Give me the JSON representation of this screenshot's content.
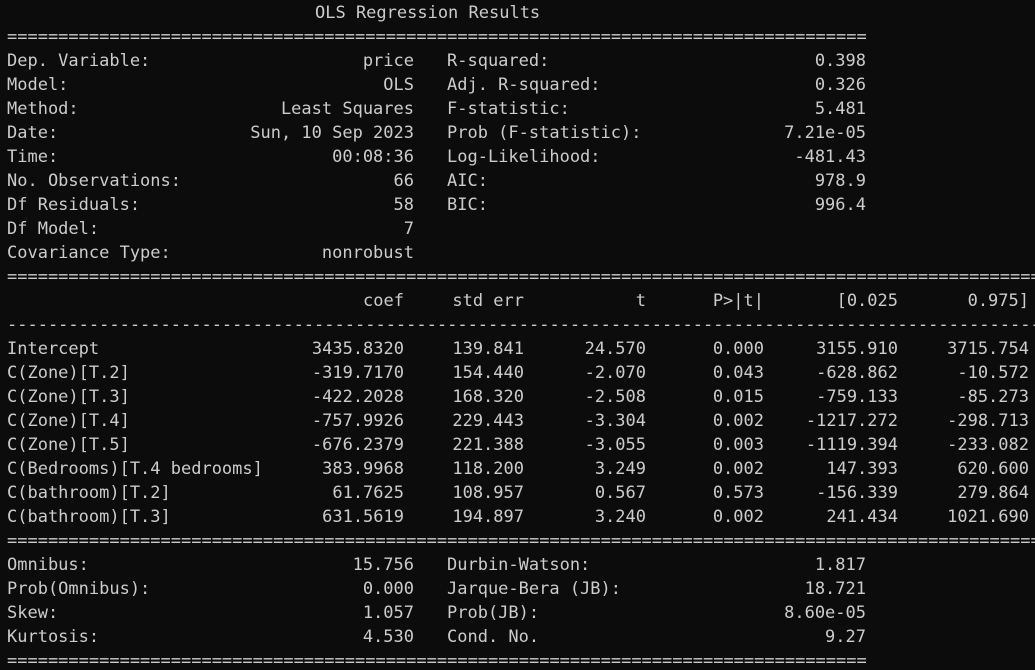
{
  "title": "OLS Regression Results",
  "rules": {
    "double_long": "=======================================================================================================================================================================",
    "double_short": "==============================================================================================================",
    "single_long": "-----------------------------------------------------------------------------------------------------------------------------------------------------------------------"
  },
  "summary": {
    "left": [
      {
        "label": "Dep. Variable:",
        "value": "price"
      },
      {
        "label": "Model:",
        "value": "OLS"
      },
      {
        "label": "Method:",
        "value": "Least Squares"
      },
      {
        "label": "Date:",
        "value": "Sun, 10 Sep 2023"
      },
      {
        "label": "Time:",
        "value": "00:08:36"
      },
      {
        "label": "No. Observations:",
        "value": "66"
      },
      {
        "label": "Df Residuals:",
        "value": "58"
      },
      {
        "label": "Df Model:",
        "value": "7"
      },
      {
        "label": "Covariance Type:",
        "value": "nonrobust"
      }
    ],
    "right": [
      {
        "label": "R-squared:",
        "value": "0.398"
      },
      {
        "label": "Adj. R-squared:",
        "value": "0.326"
      },
      {
        "label": "F-statistic:",
        "value": "5.481"
      },
      {
        "label": "Prob (F-statistic):",
        "value": "7.21e-05"
      },
      {
        "label": "Log-Likelihood:",
        "value": "-481.43"
      },
      {
        "label": "AIC:",
        "value": "978.9"
      },
      {
        "label": "BIC:",
        "value": "996.4"
      }
    ]
  },
  "coef_table": {
    "headers": [
      "coef",
      "std err",
      "t",
      "P>|t|",
      "[0.025",
      "0.975]"
    ],
    "rows": [
      {
        "name": "Intercept",
        "cells": [
          "3435.8320",
          "139.841",
          "24.570",
          "0.000",
          "3155.910",
          "3715.754"
        ]
      },
      {
        "name": "C(Zone)[T.2]",
        "cells": [
          "-319.7170",
          "154.440",
          "-2.070",
          "0.043",
          "-628.862",
          "-10.572"
        ]
      },
      {
        "name": "C(Zone)[T.3]",
        "cells": [
          "-422.2028",
          "168.320",
          "-2.508",
          "0.015",
          "-759.133",
          "-85.273"
        ]
      },
      {
        "name": "C(Zone)[T.4]",
        "cells": [
          "-757.9926",
          "229.443",
          "-3.304",
          "0.002",
          "-1217.272",
          "-298.713"
        ]
      },
      {
        "name": "C(Zone)[T.5]",
        "cells": [
          "-676.2379",
          "221.388",
          "-3.055",
          "0.003",
          "-1119.394",
          "-233.082"
        ]
      },
      {
        "name": "C(Bedrooms)[T.4 bedrooms]",
        "cells": [
          "383.9968",
          "118.200",
          "3.249",
          "0.002",
          "147.393",
          "620.600"
        ]
      },
      {
        "name": "C(bathroom)[T.2]",
        "cells": [
          "61.7625",
          "108.957",
          "0.567",
          "0.573",
          "-156.339",
          "279.864"
        ]
      },
      {
        "name": "C(bathroom)[T.3]",
        "cells": [
          "631.5619",
          "194.897",
          "3.240",
          "0.002",
          "241.434",
          "1021.690"
        ]
      }
    ]
  },
  "diagnostics": {
    "left": [
      {
        "label": "Omnibus:",
        "value": "15.756"
      },
      {
        "label": "Prob(Omnibus):",
        "value": "0.000"
      },
      {
        "label": "Skew:",
        "value": "1.057"
      },
      {
        "label": "Kurtosis:",
        "value": "4.530"
      }
    ],
    "right": [
      {
        "label": "Durbin-Watson:",
        "value": "1.817"
      },
      {
        "label": "Jarque-Bera (JB):",
        "value": "18.721"
      },
      {
        "label": "Prob(JB):",
        "value": "8.60e-05"
      },
      {
        "label": "Cond. No.",
        "value": "9.27"
      }
    ]
  },
  "colors": {
    "background": "#0c0c0c",
    "text": "#cccccc"
  }
}
